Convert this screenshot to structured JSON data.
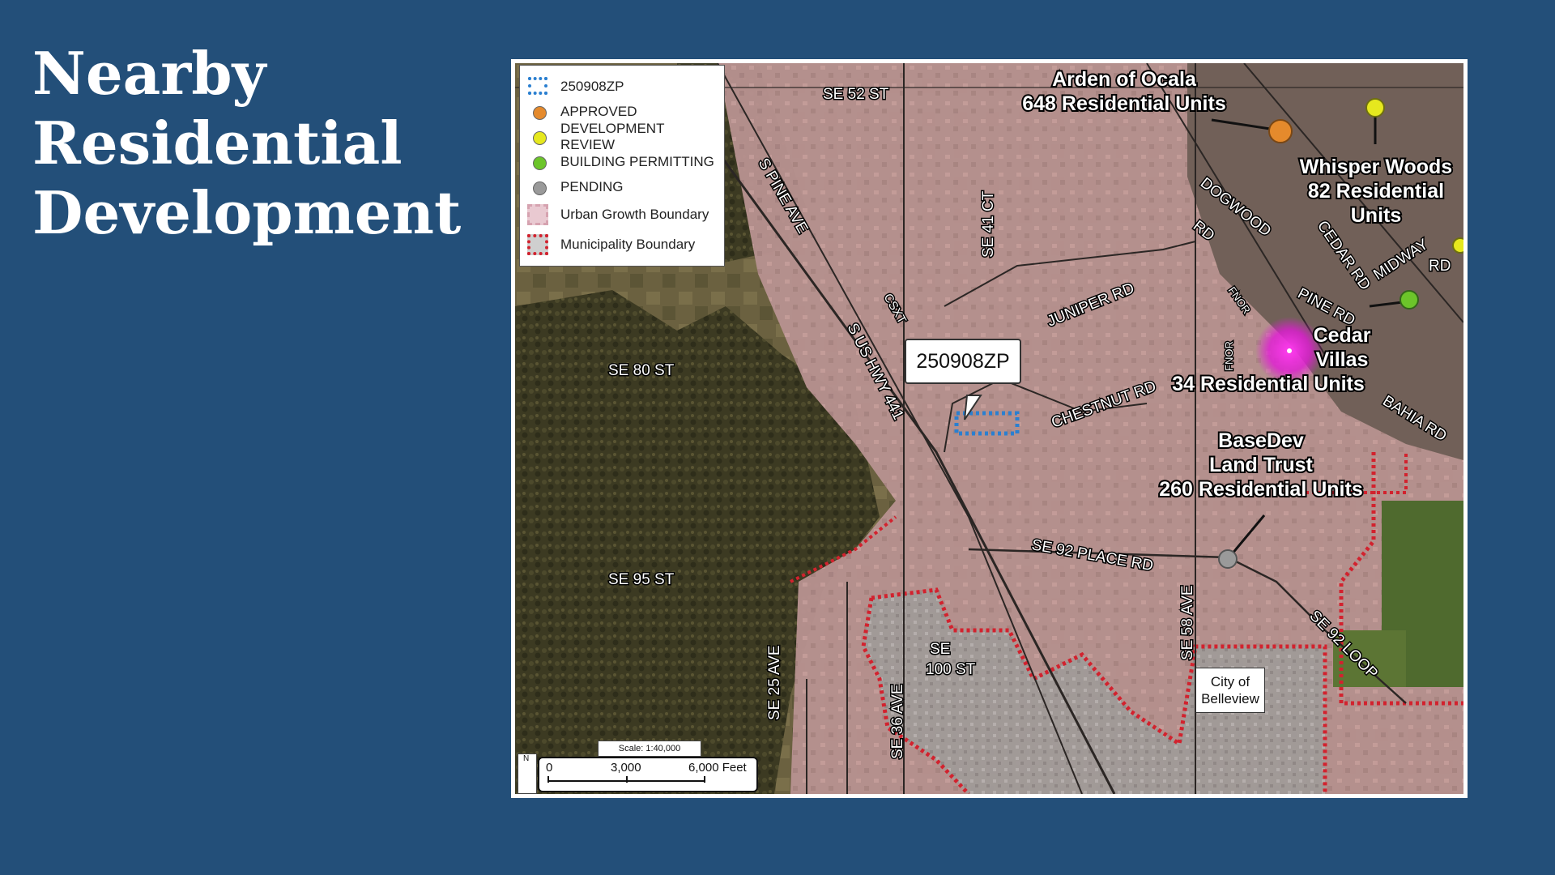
{
  "slide": {
    "title_lines": [
      "Nearby",
      "Residential",
      "Development"
    ]
  },
  "legend": {
    "items": [
      {
        "label": "250908ZP",
        "symbol": "dotted-blue-outline"
      },
      {
        "label": "APPROVED",
        "symbol": "dot",
        "color": "#e58a2c"
      },
      {
        "label": "DEVELOPMENT REVIEW",
        "symbol": "dot",
        "color": "#e6e81e"
      },
      {
        "label": "BUILDING PERMITTING",
        "symbol": "dot",
        "color": "#6cc52a"
      },
      {
        "label": "PENDING",
        "symbol": "dot",
        "color": "#9a9a9a"
      },
      {
        "label": "Urban Growth Boundary",
        "symbol": "pink-fill",
        "color": "#e9c9d1"
      },
      {
        "label": "Municipality Boundary",
        "symbol": "red-dotted-fill",
        "color": "#d2222e"
      }
    ]
  },
  "roads": [
    "SE 52 ST",
    "S PINE AVE",
    "SE 41 CT",
    "CSXT",
    "S US HWY 441",
    "JUNIPER RD",
    "SE 80 ST",
    "CHESTNUT RD",
    "SE 95 ST",
    "SE 92 PLACE RD",
    "SE 58 AVE",
    "SE",
    "100 ST",
    "SE 25 AVE",
    "SE 36 AVE",
    "SE 92 LOOP",
    "DOGWOOD",
    "RD",
    "CEDAR RD",
    "MIDWAY",
    "RD",
    "PINE RD",
    "FNOR",
    "FNOR",
    "BAHIA RD"
  ],
  "developments": [
    {
      "lines": [
        "Arden of Ocala",
        "648 Residential Units"
      ],
      "status": "APPROVED"
    },
    {
      "lines": [
        "Whisper Woods",
        "82 Residential",
        "Units"
      ],
      "status": "DEVELOPMENT REVIEW"
    },
    {
      "lines": [
        "Cedar",
        "Villas",
        "34 Residential Units"
      ],
      "status": "BUILDING PERMITTING"
    },
    {
      "lines": [
        "BaseDev",
        "Land Trust",
        "260 Residential Units"
      ],
      "status": "PENDING"
    }
  ],
  "subject_site": {
    "label": "250908ZP"
  },
  "city_label": {
    "lines": [
      "City of",
      "Belleview"
    ]
  },
  "scale": {
    "text": "Scale: 1:40,000",
    "ticks": [
      "0",
      "3,000",
      "6,000 Feet"
    ]
  },
  "north_arrow": {
    "letter": "N"
  },
  "colors": {
    "background": "#234f79",
    "approved": "#e58a2c",
    "development_review": "#e6e81e",
    "building_permitting": "#6cc52a",
    "pending": "#9a9a9a",
    "cedar_villas_highlight": "#e21bd6",
    "subject_site_outline": "#2a7fd0",
    "municipality_boundary": "#d2222e"
  }
}
